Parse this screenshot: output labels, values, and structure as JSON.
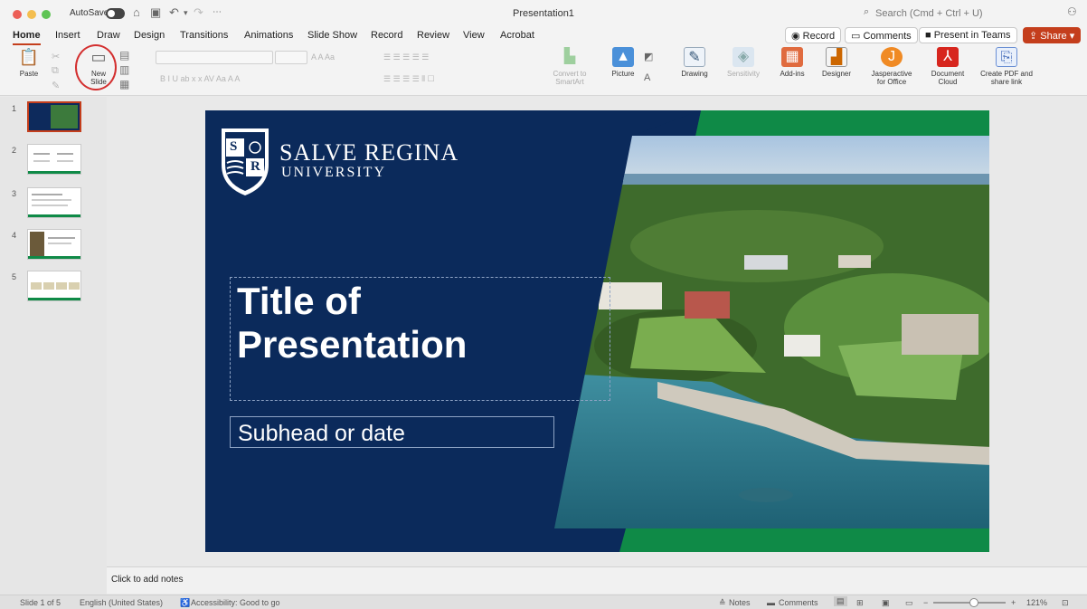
{
  "window": {
    "autosave_label": "AutoSave",
    "title": "Presentation1",
    "search_placeholder": "Search (Cmd + Ctrl + U)"
  },
  "tabs": [
    "Home",
    "Insert",
    "Draw",
    "Design",
    "Transitions",
    "Animations",
    "Slide Show",
    "Record",
    "Review",
    "View",
    "Acrobat"
  ],
  "header_buttons": {
    "record": "Record",
    "comments": "Comments",
    "present_in_teams": "Present in Teams",
    "share": "Share"
  },
  "ribbon": {
    "paste": "Paste",
    "new_slide": "New Slide",
    "convert_smartart": "Convert to SmartArt",
    "picture": "Picture",
    "drawing": "Drawing",
    "sensitivity": "Sensitivity",
    "add_ins": "Add-ins",
    "designer": "Designer",
    "jasperactive": "Jasperactive for Office",
    "document_cloud": "Document Cloud",
    "create_pdf": "Create PDF and share link"
  },
  "thumbnails": [
    "1",
    "2",
    "3",
    "4",
    "5"
  ],
  "slide": {
    "logo_line1": "SALVE REGINA",
    "logo_line2": "UNIVERSITY",
    "shield_s": "S",
    "shield_r": "R",
    "title": "Title of Presentation",
    "subtitle": "Subhead or date"
  },
  "notes_placeholder": "Click to add notes",
  "status": {
    "slide_count": "Slide 1 of 5",
    "language": "English (United States)",
    "accessibility": "Accessibility: Good to go",
    "notes": "Notes",
    "comments": "Comments",
    "zoom": "121%"
  },
  "colors": {
    "accent": "#c43e1c",
    "slide_navy": "#0b2a5b",
    "slide_green": "#0f8a47"
  }
}
